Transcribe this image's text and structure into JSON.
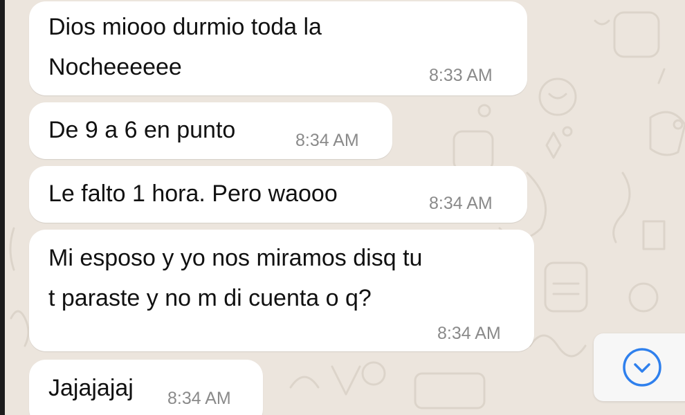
{
  "messages": [
    {
      "text": "Dios miooo durmio toda la\nNocheeeeee",
      "time": "8:33 AM"
    },
    {
      "text": "De 9 a 6 en punto",
      "time": "8:34 AM"
    },
    {
      "text": "Le falto 1 hora. Pero waooo",
      "time": "8:34 AM"
    },
    {
      "text": "Mi esposo y yo nos miramos disq tu\nt paraste y no m di cuenta o q?",
      "time": "8:34 AM"
    },
    {
      "text": "Jajajajaj",
      "time": "8:34 AM"
    }
  ],
  "colors": {
    "chat_background": "#ece5dd",
    "bubble": "#ffffff",
    "timestamp": "#8a8a8a",
    "scroll_icon": "#2f80ed"
  },
  "icons": {
    "scroll_to_bottom": "chevron-down-circle-icon",
    "wallpaper_badge": "hi-badge-icon"
  }
}
